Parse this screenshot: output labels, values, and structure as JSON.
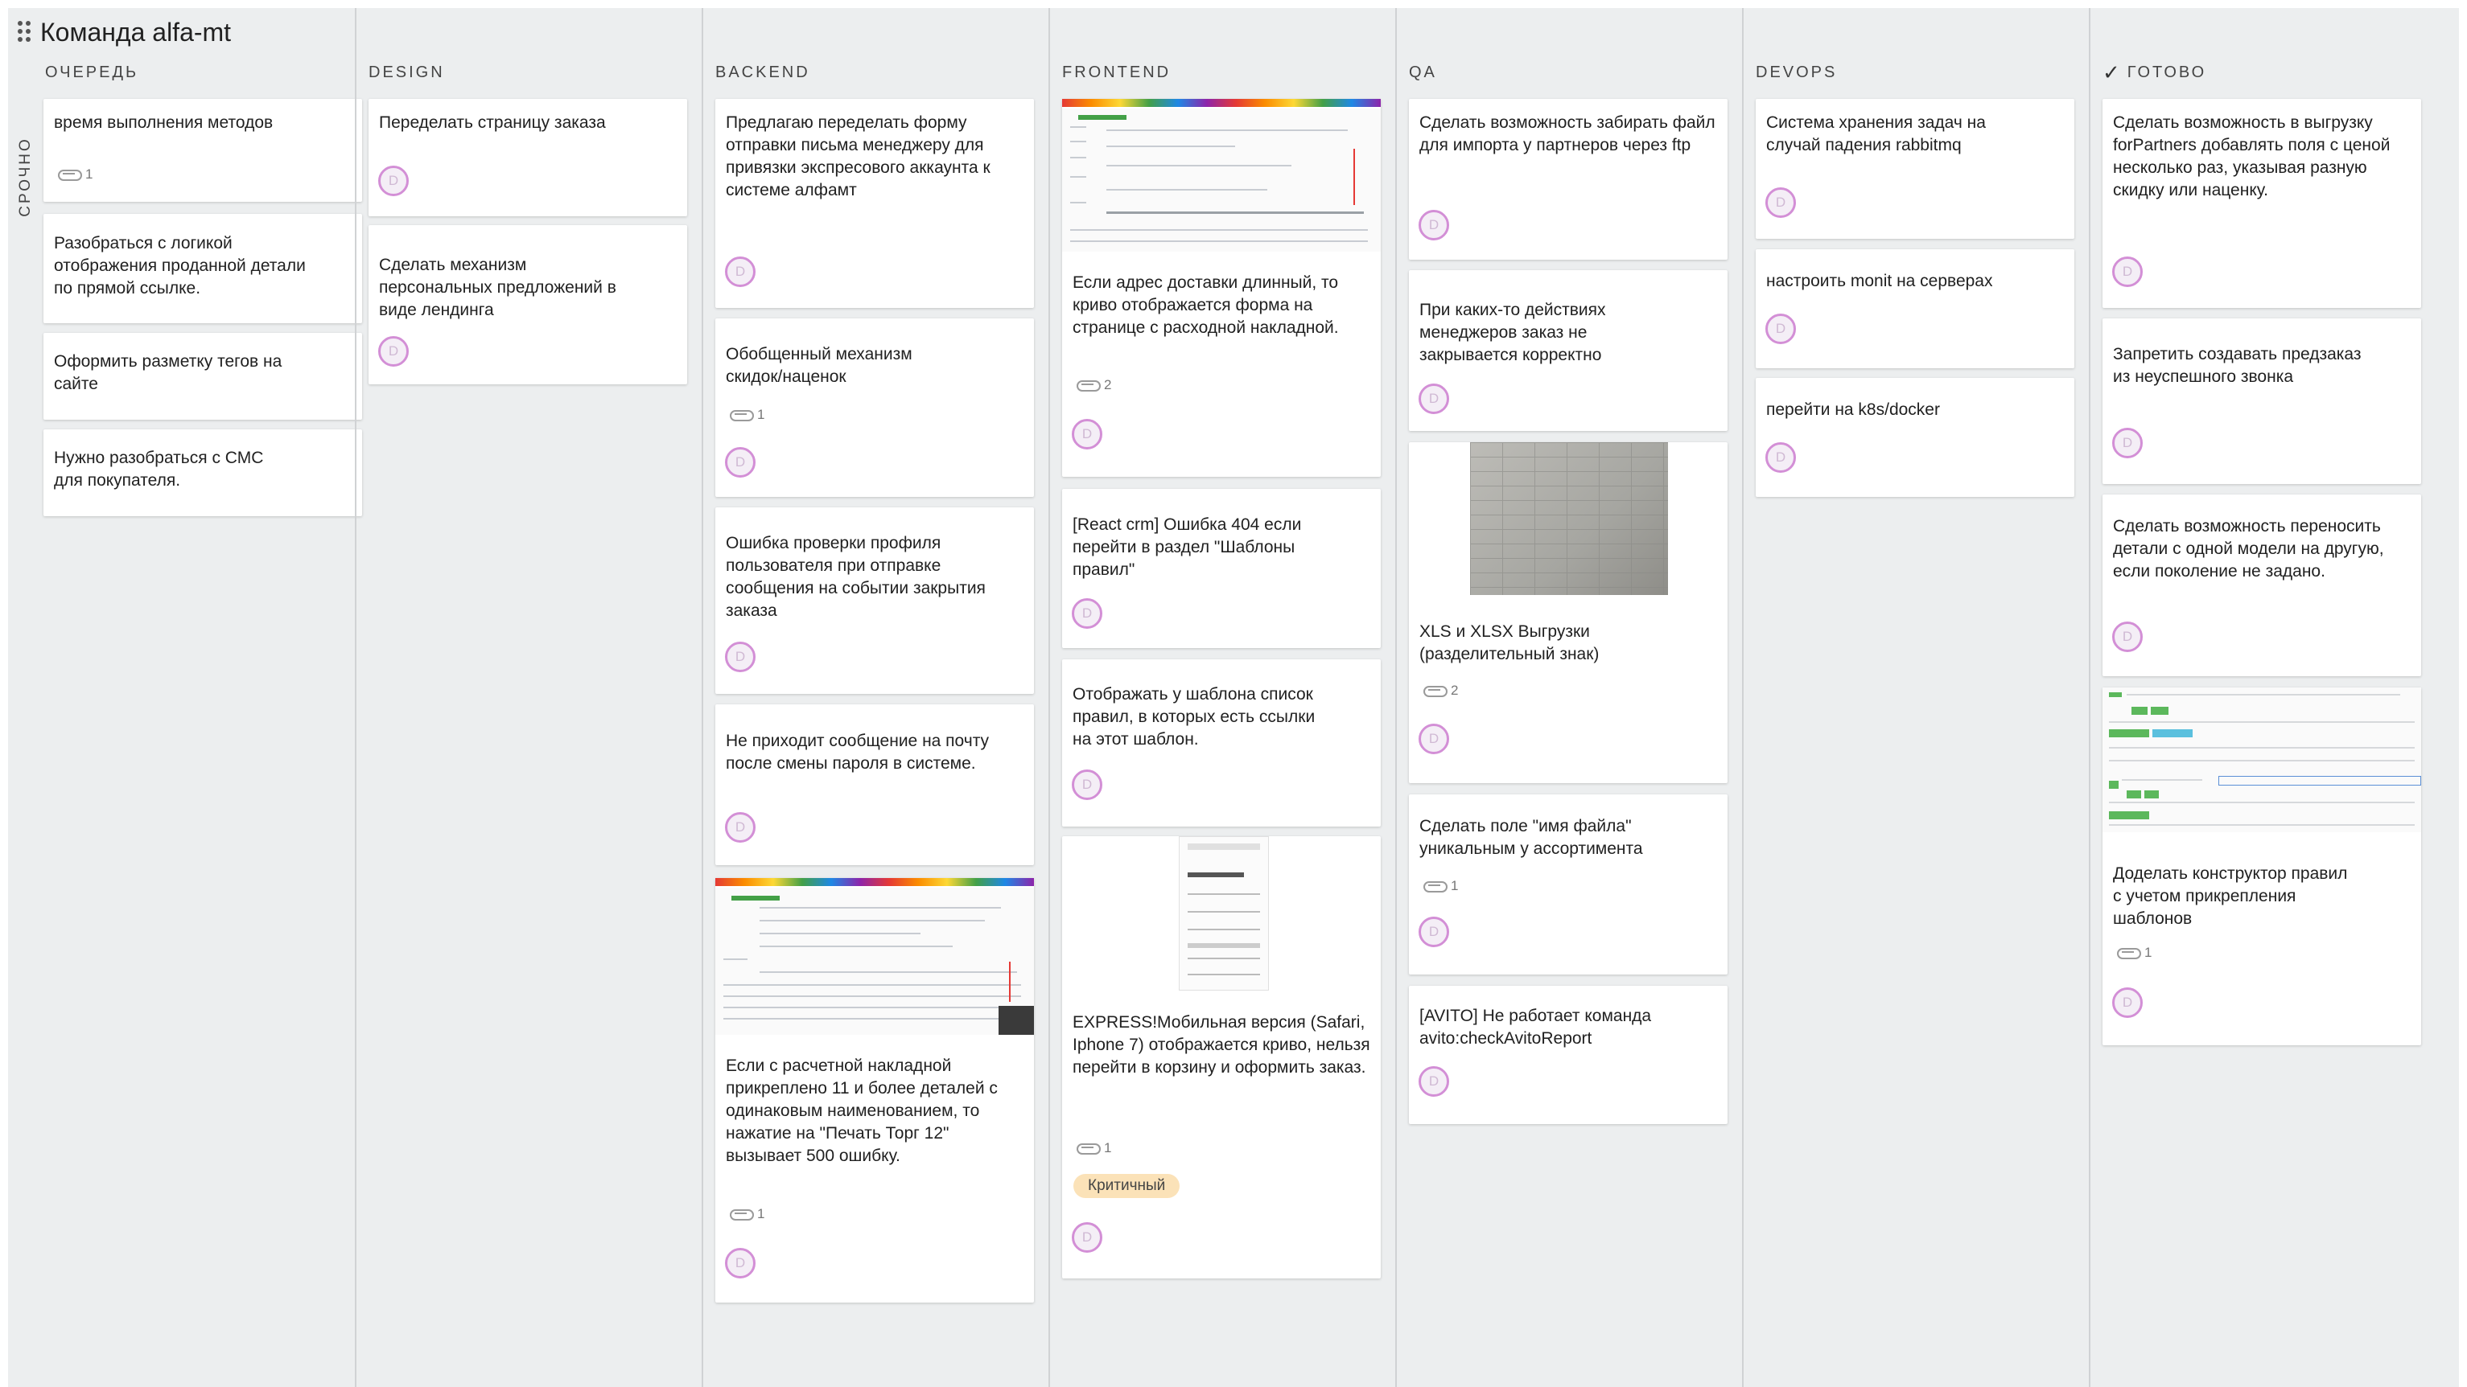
{
  "board": {
    "title": "Команда alfa-mt",
    "swimlane": "СРОЧНО"
  },
  "columns": [
    {
      "title": "ОЧЕРЕДЬ",
      "cards": [
        {
          "title": "время выполнения методов",
          "attachments": "1"
        },
        {
          "title": "Разобраться с логикой отображения проданной детали по прямой ссылке."
        },
        {
          "title": "Оформить разметку тегов на сайте"
        },
        {
          "title": "Нужно разобраться с СМС для покупателя."
        }
      ]
    },
    {
      "title": "DESIGN",
      "cards": [
        {
          "title": "Переделать страницу заказа",
          "avatar": "D"
        },
        {
          "title": "Сделать механизм персональных предложений в виде лендинга",
          "avatar": "D"
        }
      ]
    },
    {
      "title": "BACKEND",
      "cards": [
        {
          "title": "Предлагаю переделать форму отправки письма менеджеру для привязки экспресового аккаунта к системе алфамт",
          "avatar": "D"
        },
        {
          "title": "Обобщенный механизм скидок/наценок",
          "attachments": "1",
          "avatar": "D"
        },
        {
          "title": "Ошибка проверки профиля пользователя при отправке сообщения на событии закрытия заказа",
          "avatar": "D"
        },
        {
          "title": "Не приходит сообщение на почту после смены пароля в системе.",
          "avatar": "D"
        },
        {
          "title": "Если с расчетной накладной прикреплено 11 и более деталей с одинаковым наименованием, то нажатие на \"Печать Торг 12\" вызывает 500 ошибку.",
          "attachments": "1",
          "avatar": "D"
        }
      ]
    },
    {
      "title": "FRONTEND",
      "cards": [
        {
          "title": "Если адрес доставки длинный, то криво отображается форма на странице с расходной накладной.",
          "attachments": "2",
          "avatar": "D"
        },
        {
          "title": "[React crm] Ошибка 404 если перейти в раздел \"Шаблоны правил\"",
          "avatar": "D"
        },
        {
          "title": "Отображать у шаблона список правил, в которых есть ссылки на этот шаблон.",
          "avatar": "D"
        },
        {
          "title": "EXPRESS!Мобильная версия (Safari, Iphone 7) отображается криво, нельзя перейти в корзину и оформить заказ.",
          "attachments": "1",
          "badge": "Критичный",
          "avatar": "D"
        }
      ]
    },
    {
      "title": "QA",
      "cards": [
        {
          "title": "Сделать возможность забирать файл для импорта у партнеров через ftp",
          "avatar": "D"
        },
        {
          "title": "При каких-то действиях менеджеров заказ не закрывается корректно",
          "avatar": "D"
        },
        {
          "title": "XLS и XLSX Выгрузки (разделительный знак)",
          "attachments": "2",
          "avatar": "D"
        },
        {
          "title": "Сделать поле \"имя файла\" уникальным у ассортимента",
          "attachments": "1",
          "avatar": "D"
        },
        {
          "title": "[AVITO] Не работает команда avito:checkAvitoReport",
          "avatar": "D"
        }
      ]
    },
    {
      "title": "DEVOPS",
      "cards": [
        {
          "title": "Система хранения задач на случай падения rabbitmq",
          "avatar": "D"
        },
        {
          "title": "настроить monit на серверах",
          "avatar": "D"
        },
        {
          "title": "перейти на k8s/docker",
          "avatar": "D"
        }
      ]
    },
    {
      "title": "ГОТОВО",
      "cards": [
        {
          "title": "Сделать возможность в выгрузку forPartners добавлять поля с ценой несколько раз, указывая разную скидку или наценку.",
          "avatar": "D"
        },
        {
          "title": "Запретить создавать предзаказ из неуспешного звонка",
          "avatar": "D"
        },
        {
          "title": "Сделать возможность переносить детали с одной модели на другую, если поколение не задано.",
          "avatar": "D"
        },
        {
          "title": "Доделать конструктор правил с учетом прикрепления шаблонов",
          "attachments": "1",
          "avatar": "D"
        }
      ]
    }
  ],
  "icons": {
    "drag": "drag-handle-icon",
    "attachment": "paperclip-icon",
    "done": "check-icon"
  },
  "colors": {
    "board_bg": "#eceeef",
    "avatar_ring": "#d38fd6",
    "critical_badge": "#fbe2b8"
  }
}
